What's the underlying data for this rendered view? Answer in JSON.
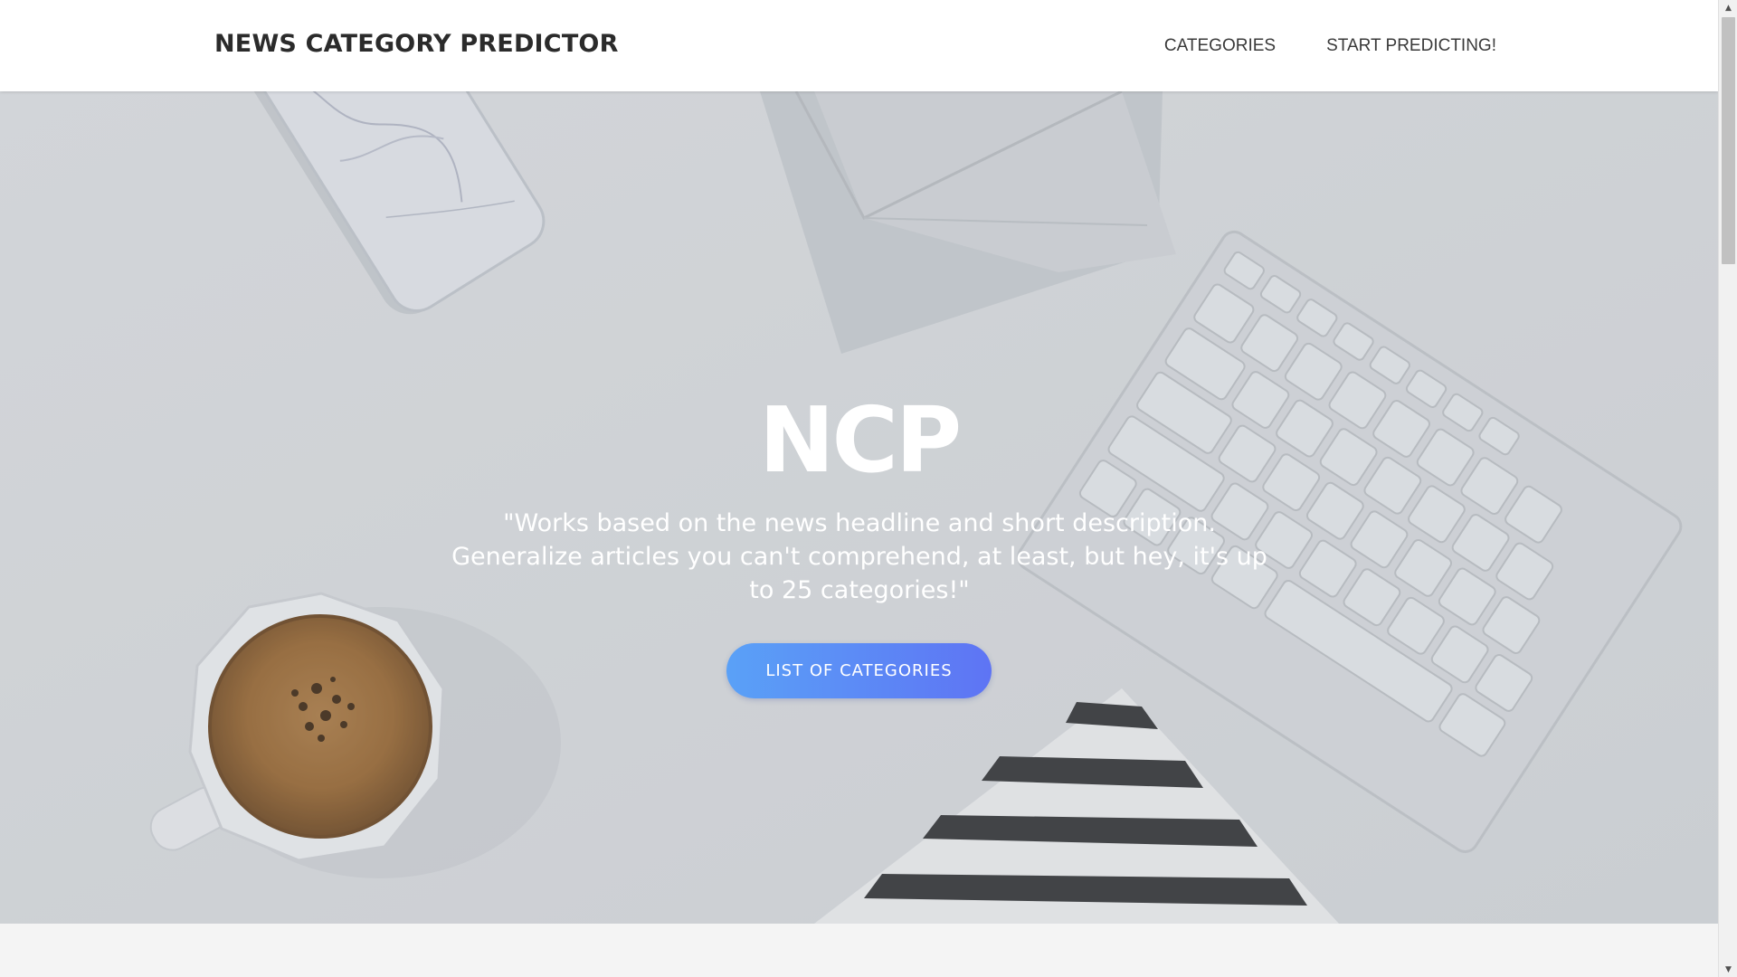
{
  "navbar": {
    "brand": "NEWS CATEGORY PREDICTOR",
    "links": [
      {
        "label": "CATEGORIES"
      },
      {
        "label": "START PREDICTING!"
      }
    ]
  },
  "hero": {
    "title": "NCP",
    "quote": "\"Works based on the news headline and short description. Generalize articles you can't comprehend, at least, but hey, it's up to 25 categories!\"",
    "button_label": "LIST OF CATEGORIES"
  },
  "colors": {
    "button_gradient_start": "#5aa1f7",
    "button_gradient_end": "#5e74f4",
    "navbar_bg": "#ffffff",
    "brand_text": "#2b2b2b",
    "hero_text": "#ffffff"
  },
  "icons": {
    "scroll_up": "▲",
    "scroll_down": "▼"
  }
}
